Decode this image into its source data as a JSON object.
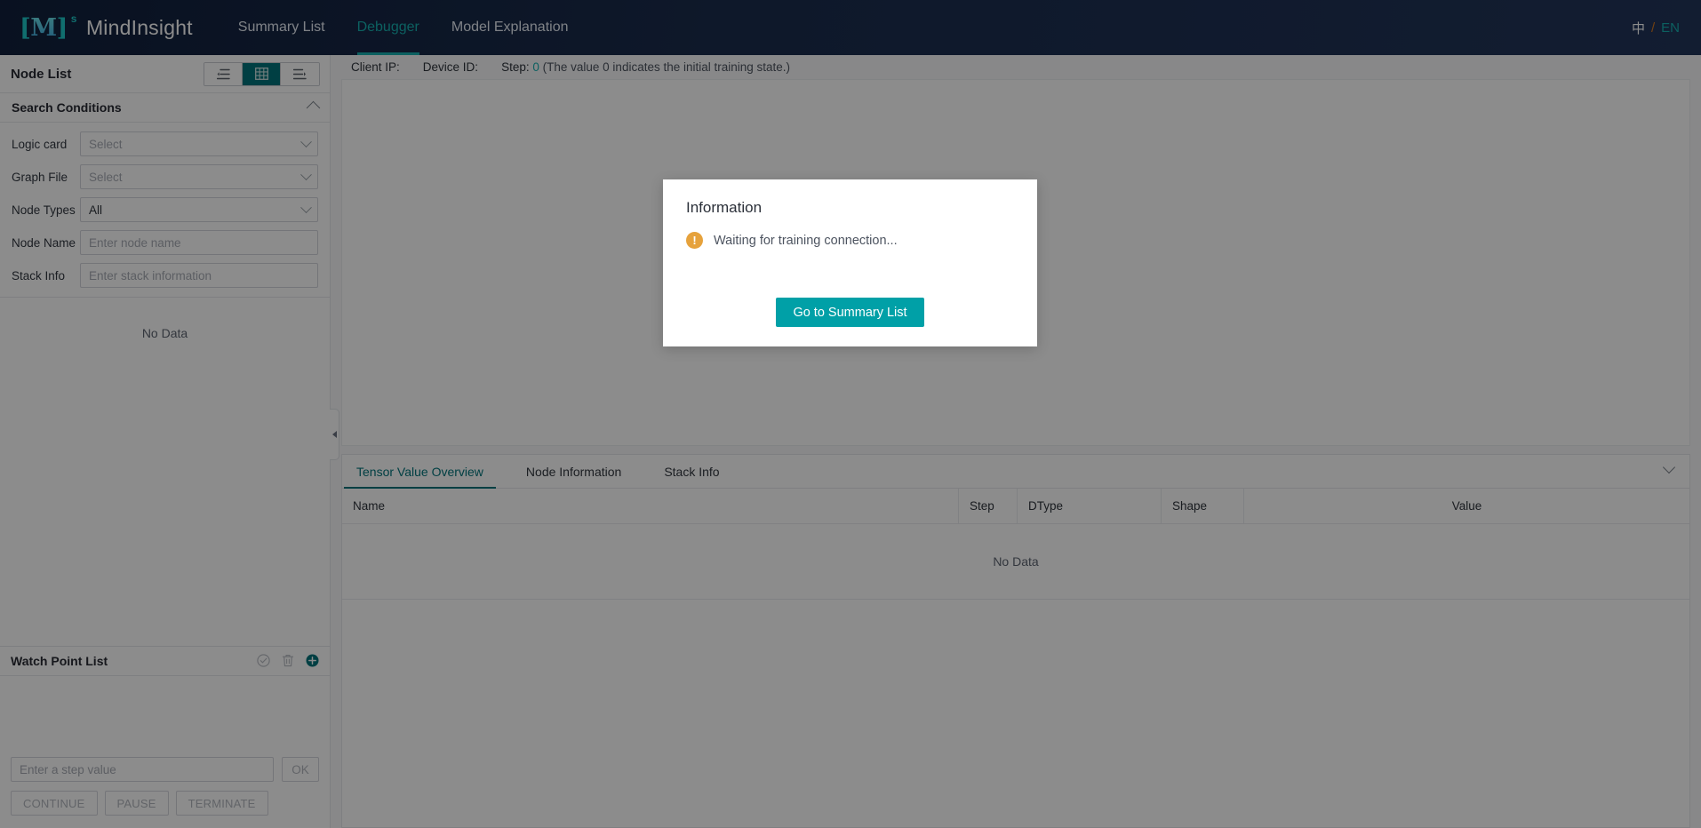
{
  "header": {
    "logo": {
      "bracket_left": "[",
      "letter": "M",
      "bracket_right": "]",
      "superscript": "s",
      "icon_name": "mindinsight-logo-icon"
    },
    "title": "MindInsight",
    "nav": [
      {
        "label": "Summary List",
        "active": false
      },
      {
        "label": "Debugger",
        "active": true
      },
      {
        "label": "Model Explanation",
        "active": false
      }
    ],
    "language": {
      "cn": "中",
      "separator": "/",
      "en": "EN",
      "active": "EN"
    }
  },
  "sidebar": {
    "node_list": {
      "title": "Node List",
      "view_toggles": [
        {
          "icon": "list-collapse-icon",
          "active": false
        },
        {
          "icon": "grid-view-icon",
          "active": true
        },
        {
          "icon": "list-expand-icon",
          "active": false
        }
      ]
    },
    "search_conditions": {
      "title": "Search Conditions",
      "collapse_icon": "chevron-up-icon",
      "fields": [
        {
          "label": "Logic card",
          "type": "select",
          "value": "",
          "placeholder": "Select"
        },
        {
          "label": "Graph File",
          "type": "select",
          "value": "",
          "placeholder": "Select"
        },
        {
          "label": "Node Types",
          "type": "select",
          "value": "All",
          "placeholder": ""
        },
        {
          "label": "Node Name",
          "type": "input",
          "value": "",
          "placeholder": "Enter node name"
        },
        {
          "label": "Stack Info",
          "type": "input",
          "value": "",
          "placeholder": "Enter stack information"
        }
      ]
    },
    "node_empty_text": "No Data",
    "watch_point_list": {
      "title": "Watch Point List",
      "icons": [
        {
          "name": "check-circle-icon",
          "enabled": false
        },
        {
          "name": "trash-icon",
          "enabled": false
        },
        {
          "name": "add-circle-icon",
          "enabled": true,
          "color": "#00747a"
        }
      ]
    },
    "footer": {
      "step_placeholder": "Enter a step value",
      "step_value": "",
      "ok_label": "OK",
      "buttons": [
        {
          "label": "CONTINUE",
          "enabled": false
        },
        {
          "label": "PAUSE",
          "enabled": false
        },
        {
          "label": "TERMINATE",
          "enabled": false
        }
      ]
    },
    "collapse_handle_icon": "triangle-left-icon"
  },
  "main": {
    "info_bar": {
      "client_ip_label": "Client IP:",
      "client_ip_value": "",
      "device_id_label": "Device ID:",
      "device_id_value": "",
      "step_label": "Step:",
      "step_value": "0",
      "step_note": "(The value 0 indicates the initial training state.)"
    },
    "tabs": [
      {
        "label": "Tensor Value Overview",
        "active": true
      },
      {
        "label": "Node Information",
        "active": false
      },
      {
        "label": "Stack Info",
        "active": false
      }
    ],
    "tab_collapse_icon": "chevron-down-icon",
    "table": {
      "columns": [
        "Name",
        "Step",
        "DType",
        "Shape",
        "Value"
      ],
      "rows": [],
      "empty_text": "No Data"
    }
  },
  "modal": {
    "title": "Information",
    "icon": "warning-icon",
    "icon_glyph": "!",
    "message": "Waiting for training connection...",
    "primary_button": "Go to Summary List"
  },
  "colors": {
    "accent": "#00a0a7",
    "accent_dark": "#00747a",
    "header_bg": "#1b2d4e",
    "warning": "#e6a23c",
    "nav_active": "#16b0b0"
  }
}
